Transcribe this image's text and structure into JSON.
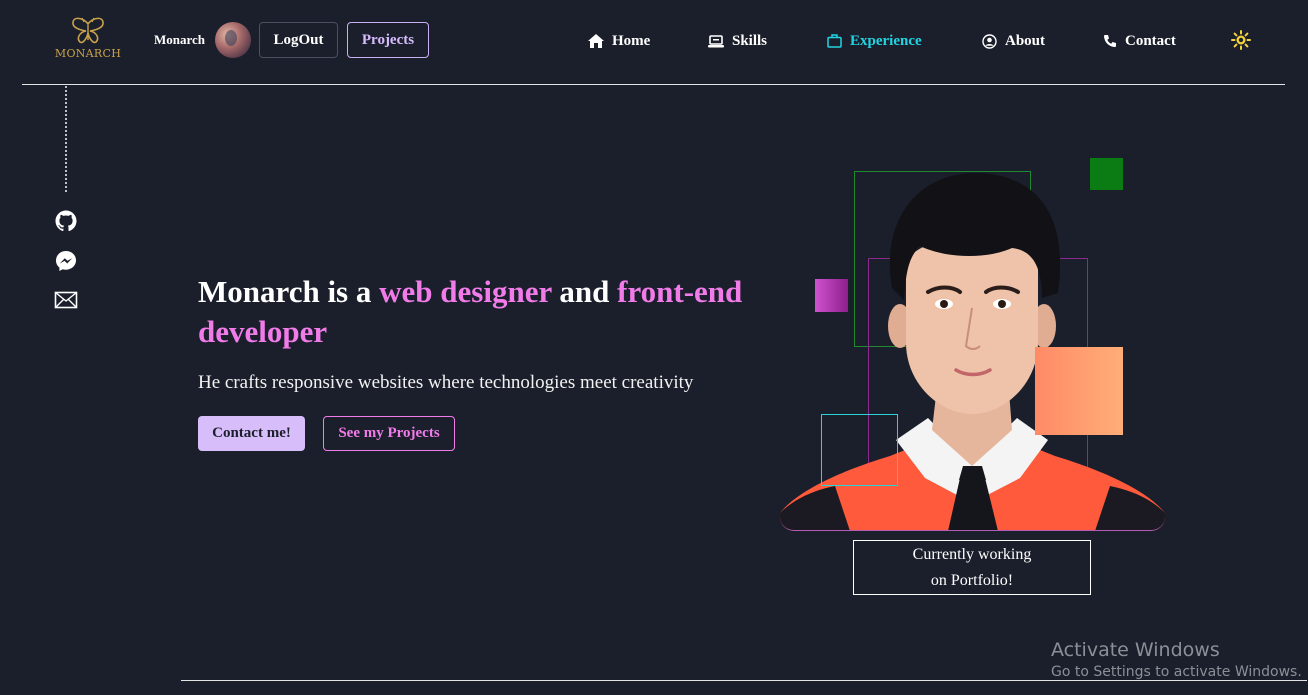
{
  "brand": {
    "logo_text": "MONARCH",
    "color": "#c9a24b"
  },
  "user": {
    "name": "Monarch"
  },
  "header": {
    "logout_label": "LogOut",
    "projects_label": "Projects",
    "nav": [
      {
        "label": "Home",
        "icon": "home-icon"
      },
      {
        "label": "Skills",
        "icon": "laptop-icon"
      },
      {
        "label": "Experience",
        "icon": "briefcase-icon",
        "active": true
      },
      {
        "label": "About",
        "icon": "user-circle-icon"
      },
      {
        "label": "Contact",
        "icon": "phone-icon"
      }
    ],
    "theme_icon": "sun-icon"
  },
  "social": [
    "github-icon",
    "messenger-icon",
    "mail-icon"
  ],
  "hero": {
    "title_part1": "Monarch is a ",
    "title_hl1": "web designer",
    "title_part2": " and ",
    "title_hl2": "front-end developer",
    "subtitle": "He crafts responsive websites where technologies meet creativity",
    "contact_label": "Contact me!",
    "see_projects_label": "See my Projects"
  },
  "caption": {
    "line1": "Currently working",
    "line2": "on Portfolio!"
  },
  "watermark": {
    "title": "Activate Windows",
    "subtitle": "Go to Settings to activate Windows."
  },
  "colors": {
    "background": "#1b1f2b",
    "accent_pink": "#f27bea",
    "accent_purple": "#d8bdfb",
    "accent_cyan": "#22d4e2"
  }
}
